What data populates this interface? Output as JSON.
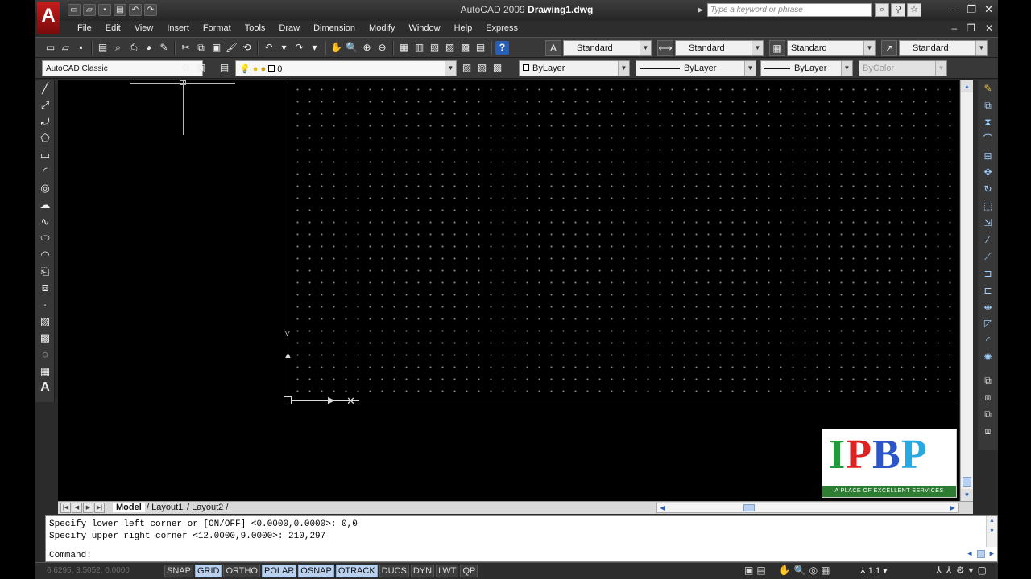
{
  "window": {
    "title_prefix": "AutoCAD 2009",
    "title_file": "Drawing1.dwg",
    "search_placeholder": "Type a keyword or phrase",
    "logo_letter": "A"
  },
  "menus": [
    "File",
    "Edit",
    "View",
    "Insert",
    "Format",
    "Tools",
    "Draw",
    "Dimension",
    "Modify",
    "Window",
    "Help",
    "Express"
  ],
  "toolbar1": {
    "text_style": "Standard",
    "dim_style": "Standard",
    "table_style": "Standard",
    "mleader_style": "Standard"
  },
  "toolbar2": {
    "workspace": "AutoCAD Classic",
    "layer": "0",
    "color": "ByLayer",
    "linetype": "ByLayer",
    "lineweight": "ByLayer",
    "plotstyle": "ByColor"
  },
  "tabs": {
    "model": "Model",
    "layout1": "Layout1",
    "layout2": "Layout2"
  },
  "command": {
    "line1": "Specify lower left corner or [ON/OFF] <0.0000,0.0000>: 0,0",
    "line2": "Specify upper right corner <12.0000,9.0000>: 210,297",
    "prompt": "Command:"
  },
  "status": {
    "coords": "6.6295, 3.5052, 0.0000",
    "toggles": [
      {
        "label": "SNAP",
        "on": false
      },
      {
        "label": "GRID",
        "on": true
      },
      {
        "label": "ORTHO",
        "on": false
      },
      {
        "label": "POLAR",
        "on": true
      },
      {
        "label": "OSNAP",
        "on": true
      },
      {
        "label": "OTRACK",
        "on": true
      },
      {
        "label": "DUCS",
        "on": false
      },
      {
        "label": "DYN",
        "on": false
      },
      {
        "label": "LWT",
        "on": false
      },
      {
        "label": "QP",
        "on": false
      }
    ],
    "annotation_scale": "1:1"
  },
  "watermark": {
    "brand_1": "I",
    "brand_2": "P",
    "brand_3": "B",
    "brand_4": "P",
    "tagline": "A PLACE OF EXCELLENT SERVICES"
  },
  "colors": {
    "toggle_on": "#b9d1ee",
    "title_bar": "#2d2d2d",
    "canvas": "#000000",
    "grid_dots": "#8a8a8a"
  }
}
